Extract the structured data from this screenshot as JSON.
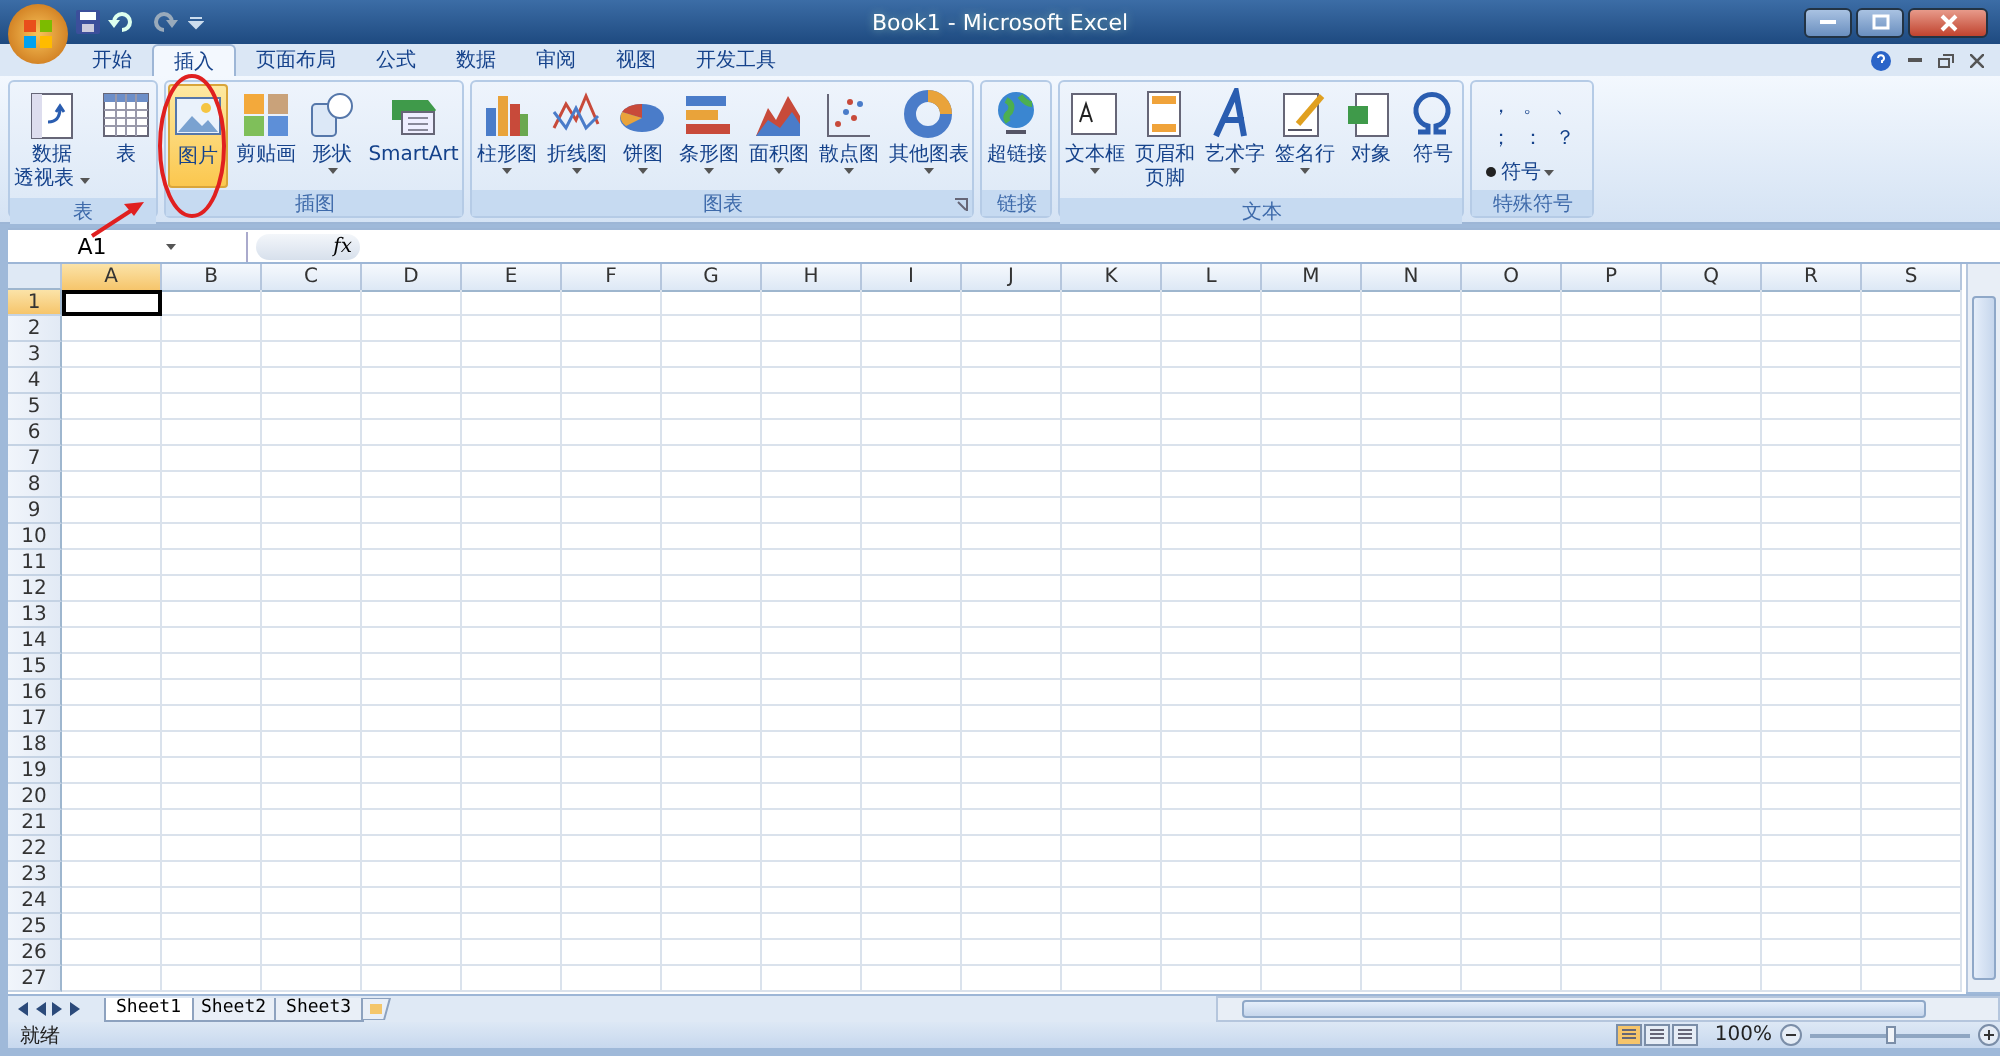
{
  "window": {
    "title": "Book1 - Microsoft Excel"
  },
  "tabs": [
    {
      "label": "开始",
      "selected": false
    },
    {
      "label": "插入",
      "selected": true
    },
    {
      "label": "页面布局",
      "selected": false
    },
    {
      "label": "公式",
      "selected": false
    },
    {
      "label": "数据",
      "selected": false
    },
    {
      "label": "审阅",
      "selected": false
    },
    {
      "label": "视图",
      "selected": false
    },
    {
      "label": "开发工具",
      "selected": false
    }
  ],
  "ribbon_groups": [
    {
      "label": "表",
      "launcher": false,
      "buttons": [
        {
          "lines": [
            "数据",
            "透视表"
          ],
          "dropdown": true,
          "selected": false
        },
        {
          "lines": [
            "表"
          ],
          "dropdown": false,
          "selected": false
        }
      ]
    },
    {
      "label": "插图",
      "launcher": false,
      "buttons": [
        {
          "lines": [
            "图片"
          ],
          "dropdown": false,
          "selected": true
        },
        {
          "lines": [
            "剪贴画"
          ],
          "dropdown": false,
          "selected": false
        },
        {
          "lines": [
            "形状"
          ],
          "dropdown": true,
          "selected": false
        },
        {
          "lines": [
            "SmartArt"
          ],
          "dropdown": false,
          "selected": false
        }
      ]
    },
    {
      "label": "图表",
      "launcher": true,
      "buttons": [
        {
          "lines": [
            "柱形图"
          ],
          "dropdown": true,
          "selected": false
        },
        {
          "lines": [
            "折线图"
          ],
          "dropdown": true,
          "selected": false
        },
        {
          "lines": [
            "饼图"
          ],
          "dropdown": true,
          "selected": false
        },
        {
          "lines": [
            "条形图"
          ],
          "dropdown": true,
          "selected": false
        },
        {
          "lines": [
            "面积图"
          ],
          "dropdown": true,
          "selected": false
        },
        {
          "lines": [
            "散点图"
          ],
          "dropdown": true,
          "selected": false
        },
        {
          "lines": [
            "其他图表"
          ],
          "dropdown": true,
          "selected": false
        }
      ]
    },
    {
      "label": "链接",
      "launcher": false,
      "buttons": [
        {
          "lines": [
            "超链接"
          ],
          "dropdown": false,
          "selected": false
        }
      ]
    },
    {
      "label": "文本",
      "launcher": false,
      "buttons": [
        {
          "lines": [
            "文本框"
          ],
          "dropdown": true,
          "selected": false
        },
        {
          "lines": [
            "页眉和",
            "页脚"
          ],
          "dropdown": false,
          "selected": false
        },
        {
          "lines": [
            "艺术字"
          ],
          "dropdown": true,
          "selected": false
        },
        {
          "lines": [
            "签名行"
          ],
          "dropdown": true,
          "selected": false
        },
        {
          "lines": [
            "对象"
          ],
          "dropdown": false,
          "selected": false
        },
        {
          "lines": [
            "符号"
          ],
          "dropdown": false,
          "selected": false
        }
      ]
    }
  ],
  "special_symbols": {
    "label": "特殊符号",
    "symbols": [
      "，",
      "。",
      "、",
      "；",
      "：",
      "？"
    ],
    "button": "符号"
  },
  "formula_bar": {
    "name_box": "A1",
    "function_label": "fx"
  },
  "columns": [
    {
      "label": "A",
      "selected": true
    },
    {
      "label": "B",
      "selected": false
    },
    {
      "label": "C",
      "selected": false
    },
    {
      "label": "D",
      "selected": false
    },
    {
      "label": "E",
      "selected": false
    },
    {
      "label": "F",
      "selected": false
    },
    {
      "label": "G",
      "selected": false
    },
    {
      "label": "H",
      "selected": false
    },
    {
      "label": "I",
      "selected": false
    },
    {
      "label": "J",
      "selected": false
    },
    {
      "label": "K",
      "selected": false
    },
    {
      "label": "L",
      "selected": false
    },
    {
      "label": "M",
      "selected": false
    },
    {
      "label": "N",
      "selected": false
    },
    {
      "label": "O",
      "selected": false
    },
    {
      "label": "P",
      "selected": false
    },
    {
      "label": "Q",
      "selected": false
    },
    {
      "label": "R",
      "selected": false
    },
    {
      "label": "S",
      "selected": false
    }
  ],
  "rows": [
    {
      "label": "1",
      "selected": true
    },
    {
      "label": "2",
      "selected": false
    },
    {
      "label": "3",
      "selected": false
    },
    {
      "label": "4",
      "selected": false
    },
    {
      "label": "5",
      "selected": false
    },
    {
      "label": "6",
      "selected": false
    },
    {
      "label": "7",
      "selected": false
    },
    {
      "label": "8",
      "selected": false
    },
    {
      "label": "9",
      "selected": false
    },
    {
      "label": "10",
      "selected": false
    },
    {
      "label": "11",
      "selected": false
    },
    {
      "label": "12",
      "selected": false
    },
    {
      "label": "13",
      "selected": false
    },
    {
      "label": "14",
      "selected": false
    },
    {
      "label": "15",
      "selected": false
    },
    {
      "label": "16",
      "selected": false
    },
    {
      "label": "17",
      "selected": false
    },
    {
      "label": "18",
      "selected": false
    },
    {
      "label": "19",
      "selected": false
    },
    {
      "label": "20",
      "selected": false
    },
    {
      "label": "21",
      "selected": false
    },
    {
      "label": "22",
      "selected": false
    },
    {
      "label": "23",
      "selected": false
    },
    {
      "label": "24",
      "selected": false
    },
    {
      "label": "25",
      "selected": false
    },
    {
      "label": "26",
      "selected": false
    },
    {
      "label": "27",
      "selected": false
    }
  ],
  "sheets": [
    {
      "label": "Sheet1",
      "selected": true
    },
    {
      "label": "Sheet2",
      "selected": false
    },
    {
      "label": "Sheet3",
      "selected": false
    }
  ],
  "status_bar": {
    "status": "就绪",
    "zoom": "100%",
    "zoom_level": {
      "level": 0.5
    }
  }
}
